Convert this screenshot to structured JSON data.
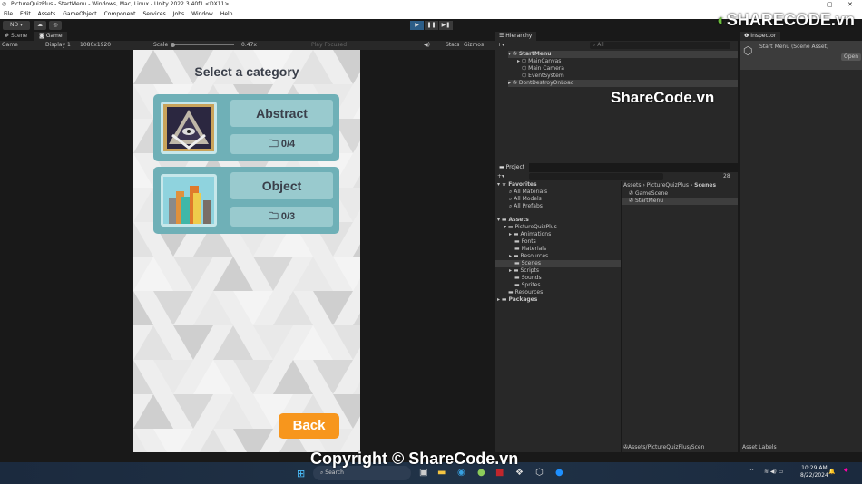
{
  "window": {
    "title": "PictureQuizPlus - StartMenu - Windows, Mac, Linux - Unity 2022.3.40f1 <DX11>"
  },
  "menu": [
    "File",
    "Edit",
    "Assets",
    "GameObject",
    "Component",
    "Services",
    "Jobs",
    "Window",
    "Help"
  ],
  "toolbar": {
    "account": "ND ▾"
  },
  "tabs": {
    "scene": "Scene",
    "game": "Game"
  },
  "game_bar": {
    "mode": "Game",
    "display": "Display 1",
    "resolution": "1080x1920",
    "scale_label": "Scale",
    "scale_value": "0.47x",
    "play_mode": "Play Focused",
    "stats": "Stats",
    "gizmos": "Gizmos"
  },
  "game": {
    "title": "Select a category",
    "categories": [
      {
        "name": "Abstract",
        "progress": "0/4"
      },
      {
        "name": "Object",
        "progress": "0/3"
      }
    ],
    "back": "Back"
  },
  "hierarchy": {
    "tab": "Hierarchy",
    "search_placeholder": "All",
    "items": [
      "StartMenu",
      "MainCanvas",
      "Main Camera",
      "EventSystem",
      "DontDestroyOnLoad"
    ]
  },
  "inspector": {
    "tab": "Inspector",
    "title": "Start Menu (Scene Asset)",
    "open": "Open",
    "asset_labels": "Asset Labels"
  },
  "project": {
    "tab": "Project",
    "count": "28",
    "favorites": "Favorites",
    "fav_items": [
      "All Materials",
      "All Models",
      "All Prefabs"
    ],
    "assets": "Assets",
    "root": "PictureQuizPlus",
    "folders": [
      "Animations",
      "Fonts",
      "Materials",
      "Resources",
      "Scenes",
      "Scripts",
      "Sounds",
      "Sprites"
    ],
    "resources": "Resources",
    "packages": "Packages",
    "breadcrumb": [
      "Assets",
      "PictureQuizPlus",
      "Scenes"
    ],
    "files": [
      "GameScene",
      "StartMenu"
    ],
    "path": "Assets/PictureQuizPlus/Scen"
  },
  "taskbar": {
    "search": "Search",
    "time": "10:29 AM",
    "date": "8/22/2024"
  },
  "watermark": {
    "logo": "SHARECODE.vn",
    "center": "ShareCode.vn",
    "bottom": "Copyright © ShareCode.vn"
  }
}
